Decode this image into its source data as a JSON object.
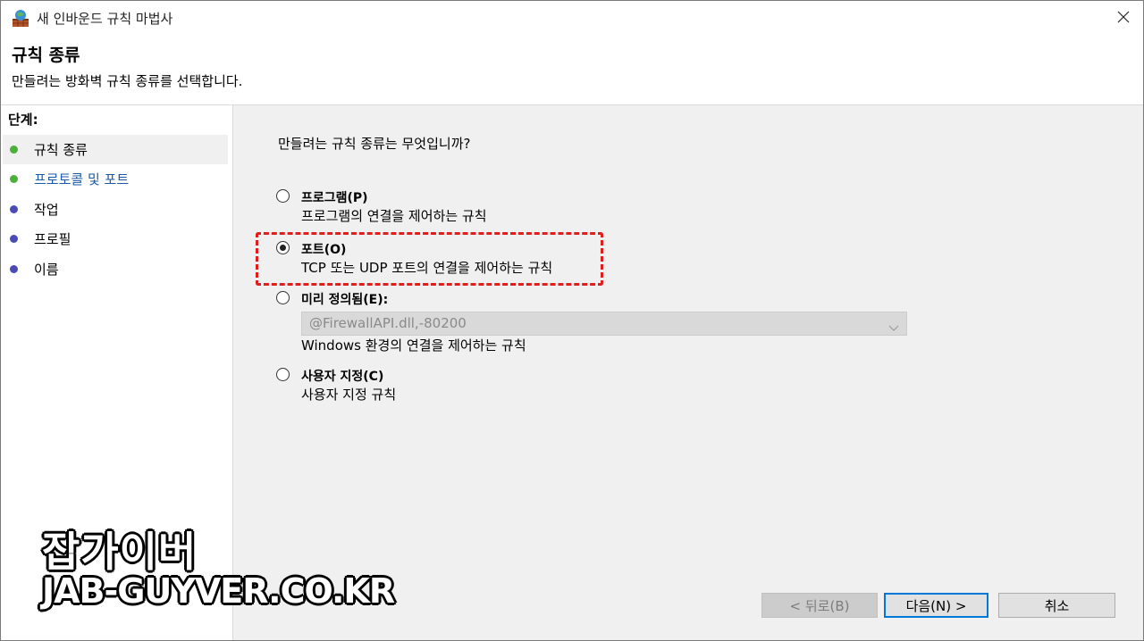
{
  "window": {
    "title": "새 인바운드 규칙 마법사"
  },
  "header": {
    "title": "규칙 종류",
    "subtitle": "만들려는 방화벽 규칙 종류를 선택합니다."
  },
  "sidebar": {
    "steps_label": "단계:",
    "items": [
      {
        "label": "규칙 종류",
        "dot_color": "#4caf3a",
        "text_color": "#000000"
      },
      {
        "label": "프로토콜 및 포트",
        "dot_color": "#4caf3a",
        "text_color": "#1a5aa6"
      },
      {
        "label": "작업",
        "dot_color": "#4a4ab8",
        "text_color": "#000000"
      },
      {
        "label": "프로필",
        "dot_color": "#4a4ab8",
        "text_color": "#000000"
      },
      {
        "label": "이름",
        "dot_color": "#4a4ab8",
        "text_color": "#000000"
      }
    ]
  },
  "main": {
    "question": "만들려는 규칙 종류는 무엇입니까?",
    "options": [
      {
        "label": "프로그램(P)",
        "desc": "프로그램의 연결을 제어하는 규칙",
        "checked": false
      },
      {
        "label": "포트(O)",
        "desc": "TCP 또는 UDP 포트의 연결을 제어하는 규칙",
        "checked": true
      },
      {
        "label": "미리 정의됨(E):",
        "desc": "Windows 환경의 연결을 제어하는 규칙",
        "checked": false
      },
      {
        "label": "사용자 지정(C)",
        "desc": "사용자 지정 규칙",
        "checked": false
      }
    ],
    "predefined_select_value": "@FirewallAPI.dll,-80200"
  },
  "buttons": {
    "back": "< 뒤로(B)",
    "next": "다음(N) >",
    "cancel": "취소"
  },
  "watermark": {
    "line1": "잡가이버",
    "line2": "JAB-GUYVER.CO.KR"
  },
  "colors": {
    "highlight": "#e01e1e",
    "main_bg": "#f0f0f0",
    "focus_border": "#0078d7"
  }
}
